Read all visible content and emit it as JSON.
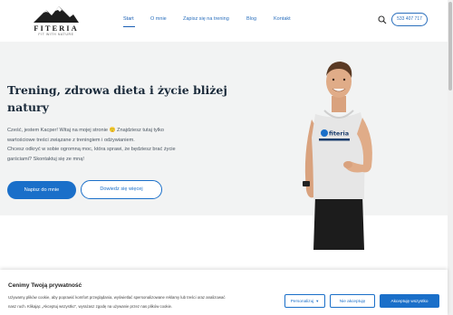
{
  "logo": {
    "name": "FITERIA",
    "tagline": "FIT WITH NATURE"
  },
  "nav": {
    "items": [
      {
        "label": "Start",
        "active": true
      },
      {
        "label": "O mnie"
      },
      {
        "label": "Zapisz się na trening"
      },
      {
        "label": "Blog"
      },
      {
        "label": "Kontakt"
      }
    ]
  },
  "header": {
    "phone": "533 407 717"
  },
  "hero": {
    "title_line1": "Trening, zdrowa dieta i życie bliżej",
    "title_line2": "natury",
    "text_line1": "Cześć, jestem Kacper! Witaj na mojej stronie 🙂 Znajdziesz tutaj tylko",
    "text_line2": "wartościowe treści związane z treningiem i odżywianiem.",
    "text_line3": "Chcesz odkryć w sobie ogromną moc, która sprawi, że będziesz brać życie",
    "text_line4": "garściami? Skontaktuj się ze mną!",
    "btn_primary": "Napisz do mnie",
    "btn_secondary": "Dowiedz się więcej",
    "shirt_text": "fiteria"
  },
  "cookie": {
    "title": "Cenimy Twoją prywatność",
    "text_line1": "Używamy plików cookie, aby poprawić komfort przeglądania, wyświetlać spersonalizowane reklamy lub treści oraz analizować",
    "text_line2": "nasz ruch. Klikając „Akceptuj wszystko\", wyrażasz zgodę na używanie przez nas plików cookie.",
    "personalize": "Personalizuj",
    "reject": "Nie akceptuję",
    "accept": "Akceptuję wszystko"
  },
  "colors": {
    "accent": "#1a6fc9",
    "hero_bg": "#f2f3f3",
    "title": "#1a2a3a"
  }
}
